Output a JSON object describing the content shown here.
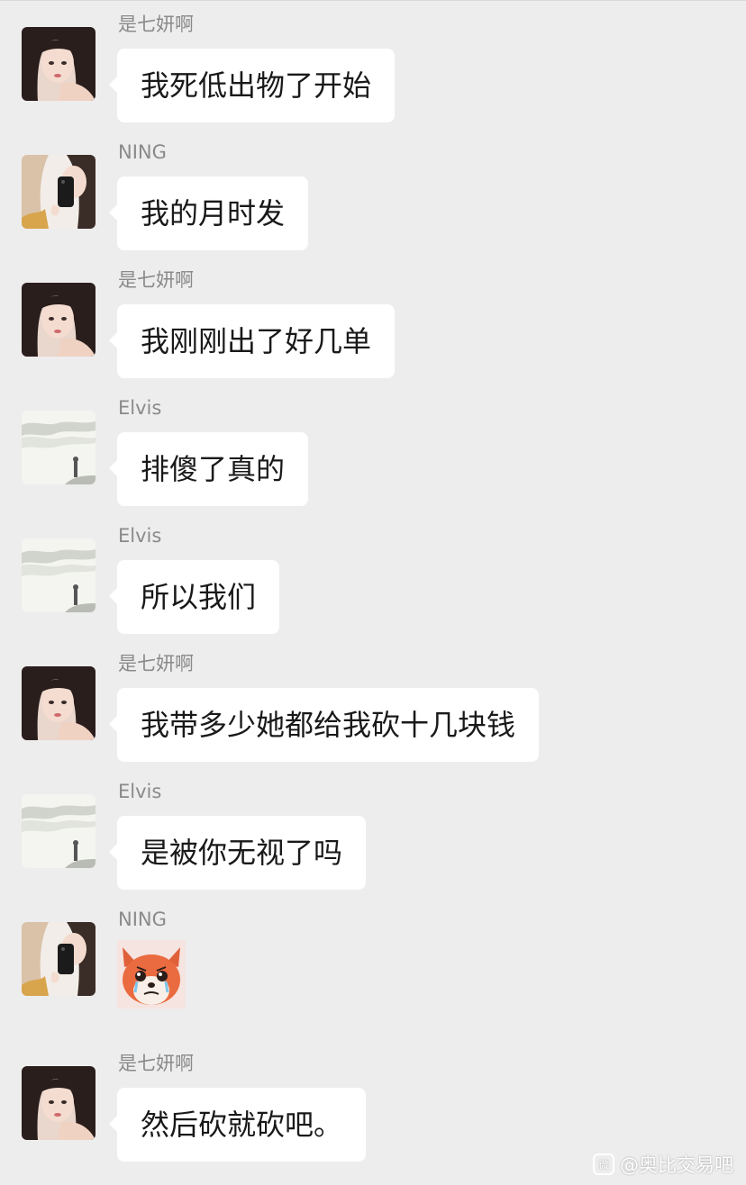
{
  "messages": [
    {
      "sender": "是七妍啊",
      "avatar": "girl",
      "text": "我死低出物了开始"
    },
    {
      "sender": "NING",
      "avatar": "phone-selfie",
      "text": "我的月时发"
    },
    {
      "sender": "是七妍啊",
      "avatar": "girl",
      "text": "我刚刚出了好几单"
    },
    {
      "sender": "Elvis",
      "avatar": "landscape",
      "text": "排傻了真的"
    },
    {
      "sender": "Elvis",
      "avatar": "landscape",
      "text": "所以我们"
    },
    {
      "sender": "是七妍啊",
      "avatar": "girl",
      "text": "我带多少她都给我砍十几块钱"
    },
    {
      "sender": "Elvis",
      "avatar": "landscape",
      "text": "是被你无视了吗"
    },
    {
      "sender": "NING",
      "avatar": "phone-selfie",
      "sticker": "crying-fox-sticker"
    },
    {
      "sender": "是七妍啊",
      "avatar": "girl",
      "text": "然后砍就砍吧。"
    }
  ],
  "watermark": {
    "icon": "weibo-icon",
    "icon_label": "微",
    "text": "@奥比交易吧"
  },
  "colors": {
    "background": "#ededed",
    "bubble": "#ffffff",
    "sender_name": "#8a8a8a"
  }
}
